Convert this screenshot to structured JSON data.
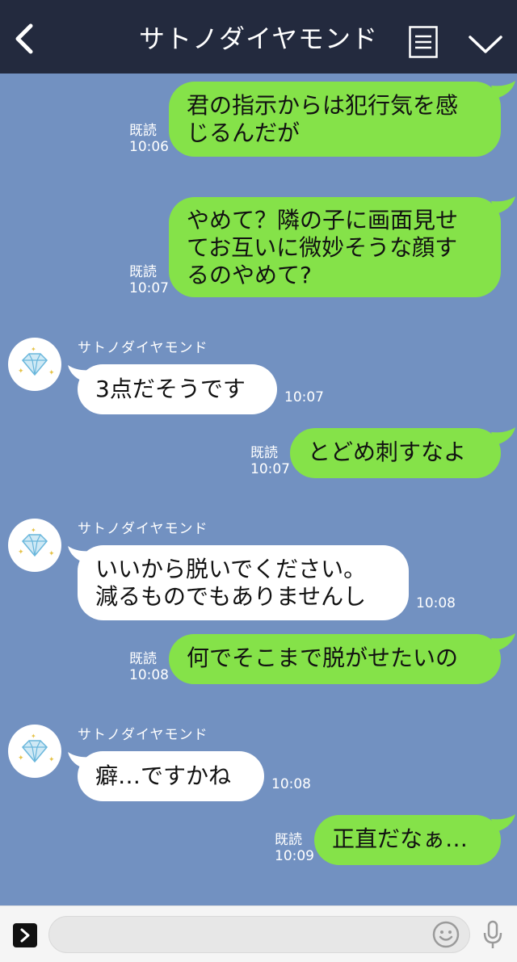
{
  "header": {
    "title": "サトノダイヤモンド"
  },
  "messages": [
    {
      "direction": "out",
      "read_label": "既読",
      "time": "10:06",
      "text": "君の指示からは犯行気を感\nじるんだが"
    },
    {
      "direction": "out",
      "read_label": "既読",
      "time": "10:07",
      "text": "やめて？隣の子に画面見せ\nてお互いに微妙そうな顔す\nるのやめて?"
    },
    {
      "direction": "in",
      "sender": "サトノダイヤモンド",
      "time": "10:07",
      "text": "3点だそうです"
    },
    {
      "direction": "out",
      "read_label": "既読",
      "time": "10:07",
      "text": "とどめ刺すなよ"
    },
    {
      "direction": "in",
      "sender": "サトノダイヤモンド",
      "time": "10:08",
      "text": "いいから脱いでください。\n減るものでもありませんし"
    },
    {
      "direction": "out",
      "read_label": "既読",
      "time": "10:08",
      "text": "何でそこまで脱がせたいの"
    },
    {
      "direction": "in",
      "sender": "サトノダイヤモンド",
      "time": "10:08",
      "text": "癖…ですかね"
    },
    {
      "direction": "out",
      "read_label": "既読",
      "time": "10:09",
      "text": "正直だなぁ…"
    }
  ],
  "input": {
    "value": "",
    "placeholder": ""
  },
  "colors": {
    "header_bg": "#232a3e",
    "chat_bg": "#7291c1",
    "outgoing_bubble": "#85e249",
    "incoming_bubble": "#ffffff"
  },
  "icons": {
    "back": "chevron-left-icon",
    "menu": "menu-list-icon",
    "collapse": "chevron-down-icon",
    "avatar": "diamond-icon",
    "expand": "chevron-right-icon",
    "emoji": "smiley-icon",
    "mic": "microphone-icon"
  }
}
